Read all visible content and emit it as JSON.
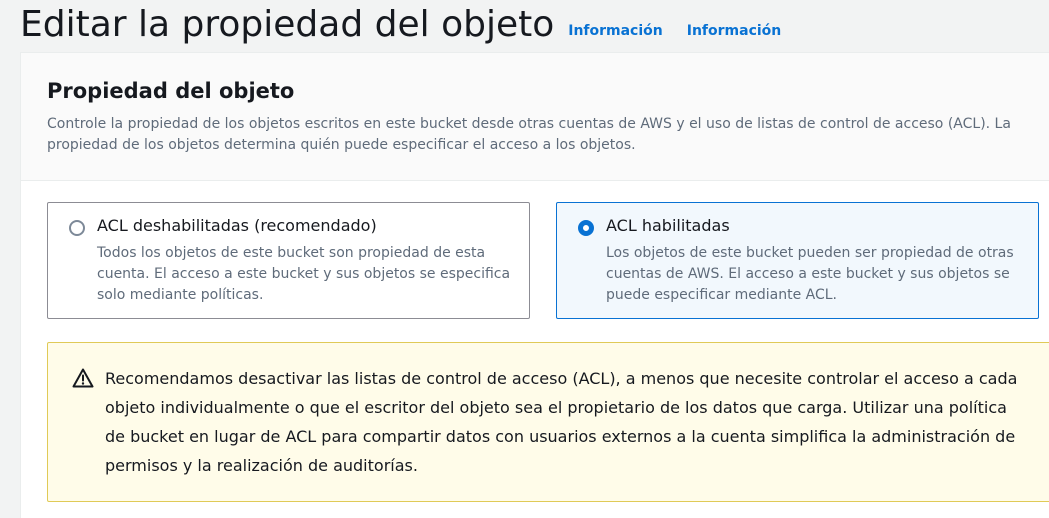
{
  "header": {
    "title": "Editar la propiedad del objeto",
    "info_links": [
      "Información",
      "Información"
    ]
  },
  "section": {
    "title": "Propiedad del objeto",
    "description": "Controle la propiedad de los objetos escritos en este bucket desde otras cuentas de AWS y el uso de listas de control de acceso (ACL). La propiedad de los objetos determina quién puede especificar el acceso a los objetos."
  },
  "options": [
    {
      "label": "ACL deshabilitadas (recomendado)",
      "description": "Todos los objetos de este bucket son propiedad de esta cuenta. El acceso a este bucket y sus objetos se especifica solo mediante políticas.",
      "selected": false
    },
    {
      "label": "ACL habilitadas",
      "description": "Los objetos de este bucket pueden ser propiedad de otras cuentas de AWS. El acceso a este bucket y sus objetos se puede especificar mediante ACL.",
      "selected": true
    }
  ],
  "alert": {
    "icon": "warning-icon",
    "text": "Recomendamos desactivar las listas de control de acceso (ACL), a menos que necesite controlar el acceso a cada objeto individualmente o que el escritor del objeto sea el propietario de los datos que carga. Utilizar una política de bucket en lugar de ACL para compartir datos con usuarios externos a la cuenta simplifica la administración de permisos y la realización de auditorías."
  },
  "colors": {
    "link": "#0972d3",
    "selected_border": "#0972d3",
    "selected_bg": "#f2f8fd",
    "warning_border": "#e0ca57",
    "warning_bg": "#fffce9"
  }
}
